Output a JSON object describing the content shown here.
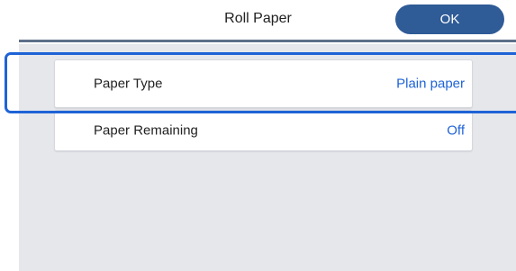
{
  "header": {
    "title": "Roll Paper",
    "ok_label": "OK"
  },
  "settings": [
    {
      "label": "Paper Type",
      "value": "Plain paper"
    },
    {
      "label": "Paper Remaining",
      "value": "Off"
    }
  ],
  "colors": {
    "accent": "#1f63d6",
    "ok_button": "#2f5b97",
    "panel_background": "#e6e7eb"
  }
}
